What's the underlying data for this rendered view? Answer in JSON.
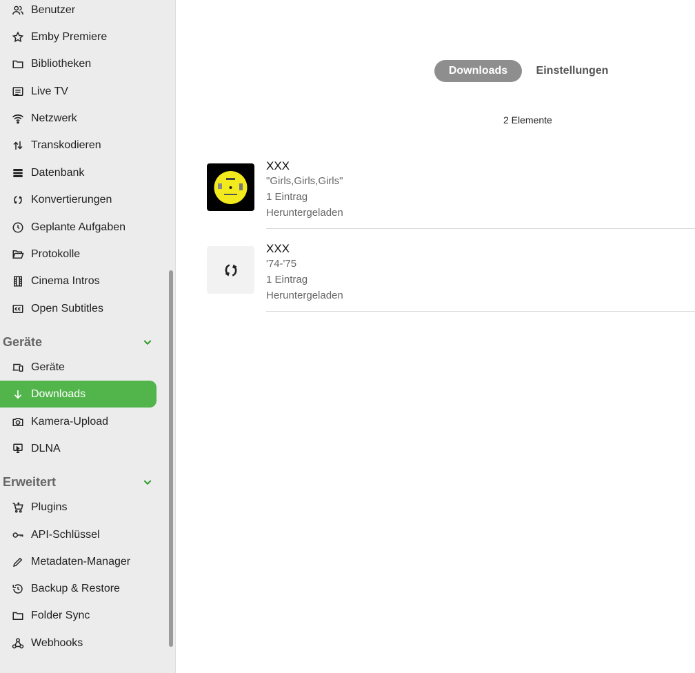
{
  "sidebar": {
    "items": [
      {
        "label": "Benutzer",
        "icon": "users-icon"
      },
      {
        "label": "Emby Premiere",
        "icon": "star-icon"
      },
      {
        "label": "Bibliotheken",
        "icon": "folder-icon"
      },
      {
        "label": "Live TV",
        "icon": "guide-icon"
      },
      {
        "label": "Netzwerk",
        "icon": "wifi-icon"
      },
      {
        "label": "Transkodieren",
        "icon": "transcode-icon"
      },
      {
        "label": "Datenbank",
        "icon": "database-icon"
      },
      {
        "label": "Konvertierungen",
        "icon": "sync-icon"
      },
      {
        "label": "Geplante Aufgaben",
        "icon": "clock-icon"
      },
      {
        "label": "Protokolle",
        "icon": "folder-open-icon"
      },
      {
        "label": "Cinema Intros",
        "icon": "film-icon"
      },
      {
        "label": "Open Subtitles",
        "icon": "closed-caption-icon"
      }
    ],
    "sections": [
      {
        "title": "Geräte",
        "items": [
          {
            "label": "Geräte",
            "icon": "devices-icon"
          },
          {
            "label": "Downloads",
            "icon": "arrow-down-icon",
            "active": true
          },
          {
            "label": "Kamera-Upload",
            "icon": "camera-icon"
          },
          {
            "label": "DLNA",
            "icon": "cast-icon"
          }
        ]
      },
      {
        "title": "Erweitert",
        "items": [
          {
            "label": "Plugins",
            "icon": "cart-icon"
          },
          {
            "label": "API-Schlüssel",
            "icon": "key-icon"
          },
          {
            "label": "Metadaten-Manager",
            "icon": "pencil-icon"
          },
          {
            "label": "Backup & Restore",
            "icon": "restore-icon"
          },
          {
            "label": "Folder Sync",
            "icon": "folder-icon"
          },
          {
            "label": "Webhooks",
            "icon": "webhook-icon"
          }
        ]
      }
    ]
  },
  "main": {
    "tabs": [
      {
        "label": "Downloads",
        "active": true
      },
      {
        "label": "Einstellungen",
        "active": false
      }
    ],
    "item_count": "2 Elemente",
    "rows": [
      {
        "title": "XXX",
        "subtitle": "\"Girls,Girls,Girls\"",
        "count": "1 Eintrag",
        "status": "Heruntergeladen",
        "thumb": "image"
      },
      {
        "title": "XXX",
        "subtitle": "'74-'75",
        "count": "1 Eintrag",
        "status": "Heruntergeladen",
        "thumb": "sync-icon"
      }
    ]
  },
  "colors": {
    "accent": "#52b54b",
    "sidebar_bg": "#ececec",
    "tab_active_bg": "#8e8e8e"
  }
}
